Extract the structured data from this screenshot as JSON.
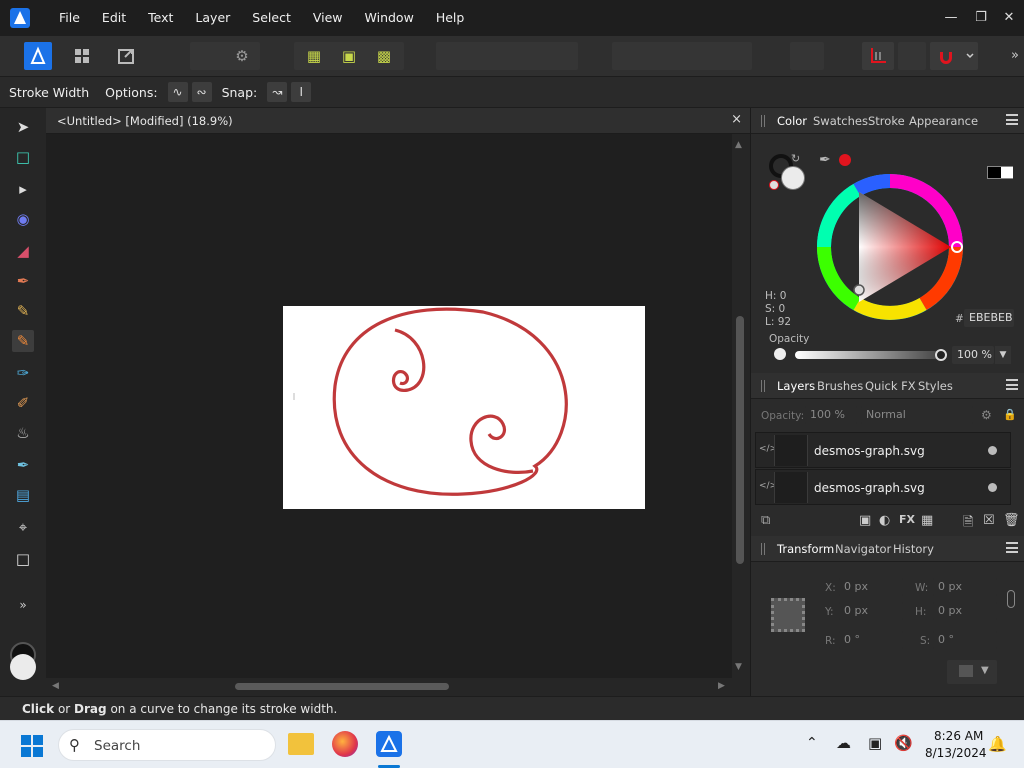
{
  "menu": {
    "items": [
      "File",
      "Edit",
      "Text",
      "Layer",
      "Select",
      "View",
      "Window",
      "Help"
    ]
  },
  "context_bar": {
    "tool_name": "Stroke Width",
    "options_label": "Options:",
    "snap_label": "Snap:"
  },
  "document": {
    "title": "<Untitled> [Modified] (18.9%)",
    "close": "×"
  },
  "color_panel": {
    "tabs": [
      "Color",
      "Swatches",
      "Stroke",
      "Appearance"
    ],
    "h": "H: 0",
    "s": "S: 0",
    "l": "L: 92",
    "hex_prefix": "#:",
    "hex": "EBEBEB",
    "opacity_label": "Opacity",
    "opacity_value": "100 %",
    "opacity_fraction": 1.0
  },
  "layers_panel": {
    "tabs": [
      "Layers",
      "Brushes",
      "Quick FX",
      "Styles"
    ],
    "opacity_label": "Opacity:",
    "opacity_value": "100 %",
    "blend_mode": "Normal",
    "layers": [
      {
        "name": "desmos-graph.svg"
      },
      {
        "name": "desmos-graph.svg"
      }
    ]
  },
  "transform_panel": {
    "tabs": [
      "Transform",
      "Navigator",
      "History"
    ],
    "x_label": "X:",
    "x": "0 px",
    "w_label": "W:",
    "w": "0 px",
    "y_label": "Y:",
    "y": "0 px",
    "h_label": "H:",
    "h": "0 px",
    "r_label": "R:",
    "r": "0 °",
    "s_label": "S:",
    "s": "0 °"
  },
  "status": {
    "bold1": "Click",
    "t1": " or ",
    "bold2": "Drag",
    "t2": " on a curve to change its stroke width."
  },
  "taskbar": {
    "search_placeholder": "Search",
    "time": "8:26 AM",
    "date": "8/13/2024"
  },
  "colors": {
    "curve": "#c0393b",
    "accent": "#1b72e8",
    "record": "#e0141e"
  }
}
